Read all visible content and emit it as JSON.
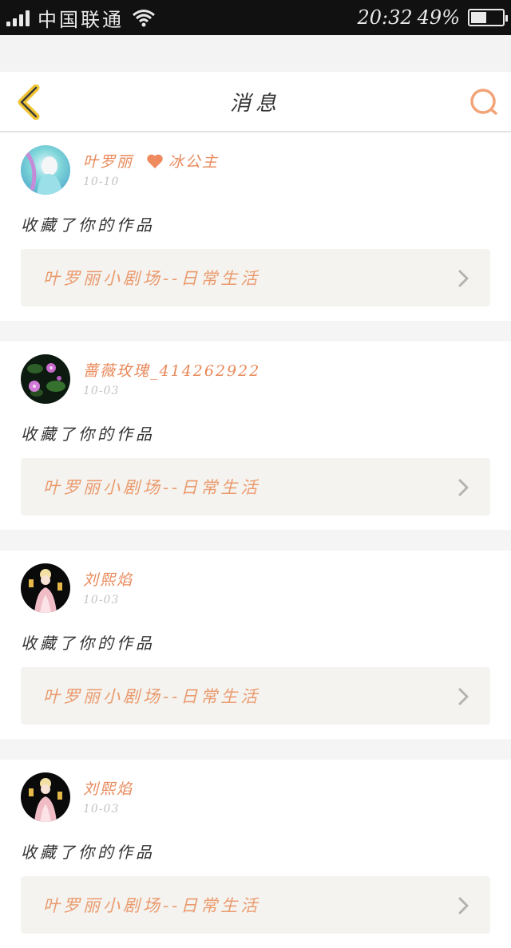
{
  "status_bar": {
    "carrier": "中国联通",
    "time": "20:32",
    "battery": "49%",
    "battery_level": 0.49
  },
  "header": {
    "title": "消息",
    "back_icon": "chevron-left-icon",
    "search_icon": "search-icon"
  },
  "colors": {
    "accent": "#e8895a",
    "back_arrow": "#f1c534",
    "link_bg": "#f4f3ef"
  },
  "messages": [
    {
      "username": "叶罗丽",
      "tag": "冰公主",
      "date": "10-10",
      "action": "收藏了你的作品",
      "work_title": "叶罗丽小剧场--日常生活"
    },
    {
      "username": "蔷薇玫瑰_414262922",
      "date": "10-03",
      "action": "收藏了你的作品",
      "work_title": "叶罗丽小剧场--日常生活"
    },
    {
      "username": "刘熙焰",
      "date": "10-03",
      "action": "收藏了你的作品",
      "work_title": "叶罗丽小剧场--日常生活"
    },
    {
      "username": "刘熙焰",
      "date": "10-03",
      "action": "收藏了你的作品",
      "work_title": "叶罗丽小剧场--日常生活"
    }
  ]
}
